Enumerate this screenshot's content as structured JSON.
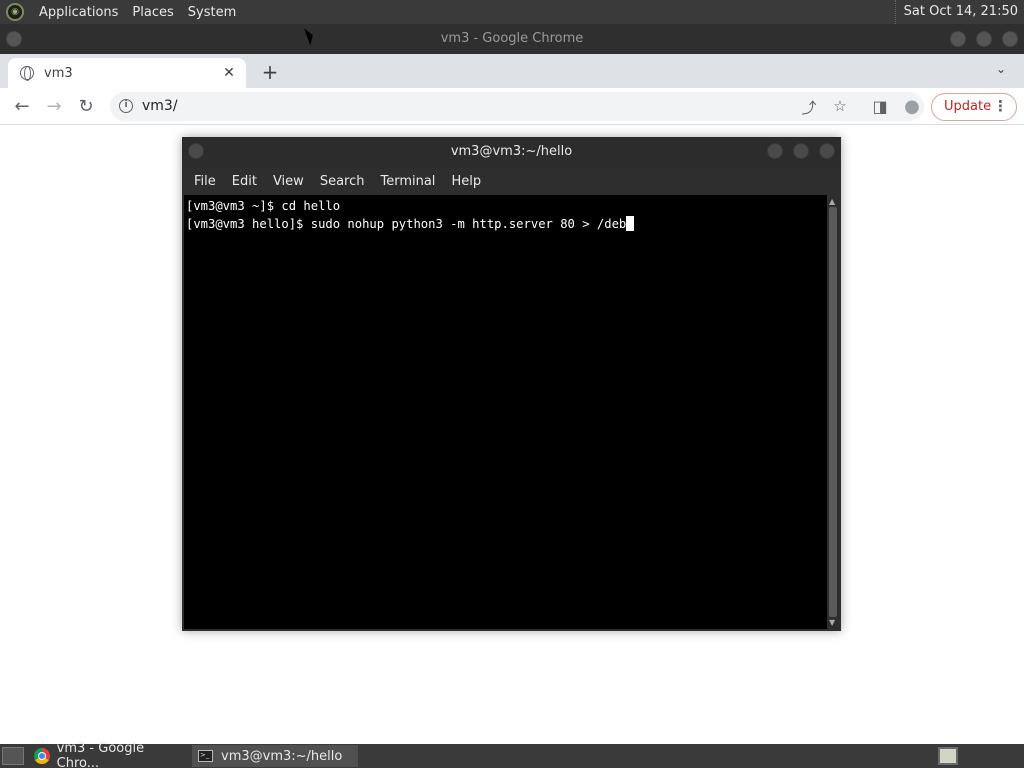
{
  "top_panel": {
    "menus": [
      "Applications",
      "Places",
      "System"
    ],
    "clock": "Sat Oct 14, 21:50"
  },
  "chrome": {
    "window_title": "vm3 - Google Chrome",
    "tab": {
      "title": "vm3",
      "close_glyph": "✕"
    },
    "new_tab_glyph": "+",
    "tab_search_glyph": "⌄",
    "toolbar": {
      "back_glyph": "←",
      "forward_glyph": "→",
      "reload_glyph": "↻",
      "url": "vm3/",
      "share_glyph": "⤴",
      "star_glyph": "☆",
      "sidepanel_glyph": "◨",
      "profile_glyph": "●",
      "update_label": "Update",
      "menu_glyph": "⋮"
    }
  },
  "terminal": {
    "title": "vm3@vm3:~/hello",
    "menu": [
      "File",
      "Edit",
      "View",
      "Search",
      "Terminal",
      "Help"
    ],
    "lines": [
      "[vm3@vm3 ~]$ cd hello",
      "[vm3@vm3 hello]$ sudo nohup python3 -m http.server 80 > /deb"
    ]
  },
  "taskbar": {
    "tasks": [
      {
        "label": "vm3 - Google Chro...",
        "icon": "chrome-icon"
      },
      {
        "label": "vm3@vm3:~/hello",
        "icon": "terminal-icon"
      }
    ]
  }
}
